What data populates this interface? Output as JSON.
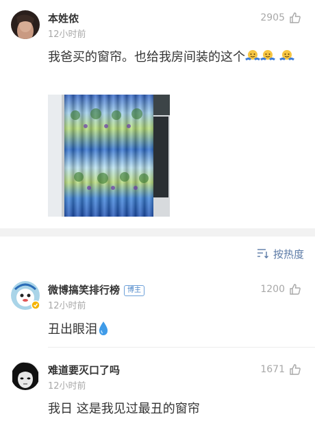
{
  "comments": [
    {
      "username": "本姓侬",
      "time": "12小时前",
      "likes": "2905",
      "text": "我爸买的窗帘。也给我房间装的这个"
    },
    {
      "username": "微博搞笑排行榜",
      "badge": "博主",
      "time": "12小时前",
      "likes": "1200",
      "text": "丑出眼泪"
    },
    {
      "username": "难道要灭口了吗",
      "time": "12小时前",
      "likes": "1671",
      "text": "我日 这是我见过最丑的窗帘"
    }
  ],
  "sort": {
    "label": "按热度"
  },
  "icons": {
    "like": "thumb-up-icon",
    "sort": "sort-icon",
    "drop": "water-drop-icon",
    "emoji": "shrug-emoji-icon"
  },
  "colors": {
    "link": "#5b7aa6",
    "muted": "#a8a8a8",
    "badge": "#4b86c8"
  }
}
